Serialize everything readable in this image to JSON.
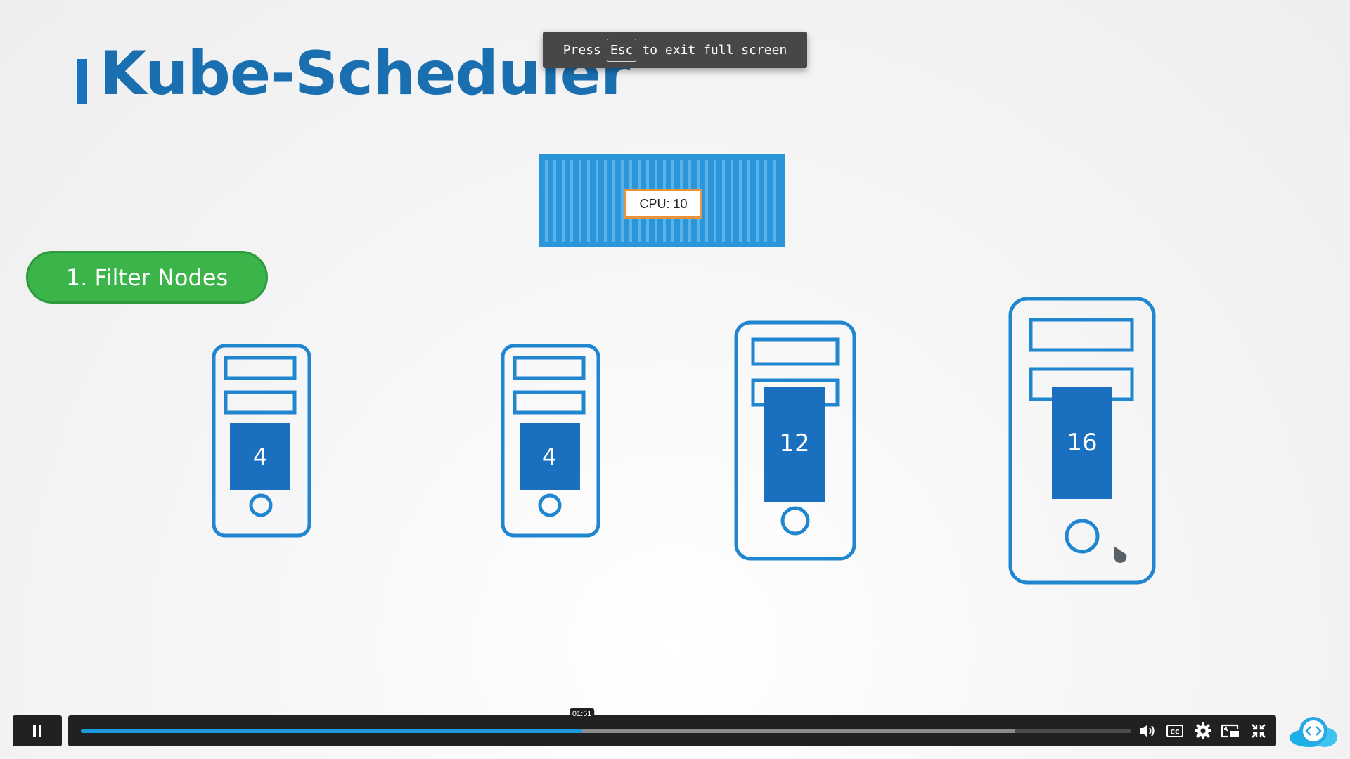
{
  "slide": {
    "title": "Kube-Scheduler",
    "step_label": "1. Filter Nodes",
    "pod_label": "CPU: 10",
    "nodes": [
      {
        "cpu": "4"
      },
      {
        "cpu": "4"
      },
      {
        "cpu": "12"
      },
      {
        "cpu": "16"
      }
    ]
  },
  "fullscreen_toast": {
    "prefix": "Press",
    "key": "Esc",
    "suffix": "to exit full screen"
  },
  "player": {
    "current_time": "01:51",
    "progress_fraction": 0.477,
    "buffered_fraction": 0.889,
    "icons": [
      "pause-icon",
      "volume-icon",
      "captions-icon",
      "settings-icon",
      "pip-icon",
      "exit-fullscreen-icon"
    ]
  },
  "colors": {
    "title": "#1a6fb0",
    "node_outline": "#1f86cf",
    "cpu_block": "#1b6fbf",
    "step_pill": "#3bb54a",
    "pod": "#2a95d8",
    "pod_label_border": "#e8923a",
    "progress": "#1a9ad8"
  }
}
